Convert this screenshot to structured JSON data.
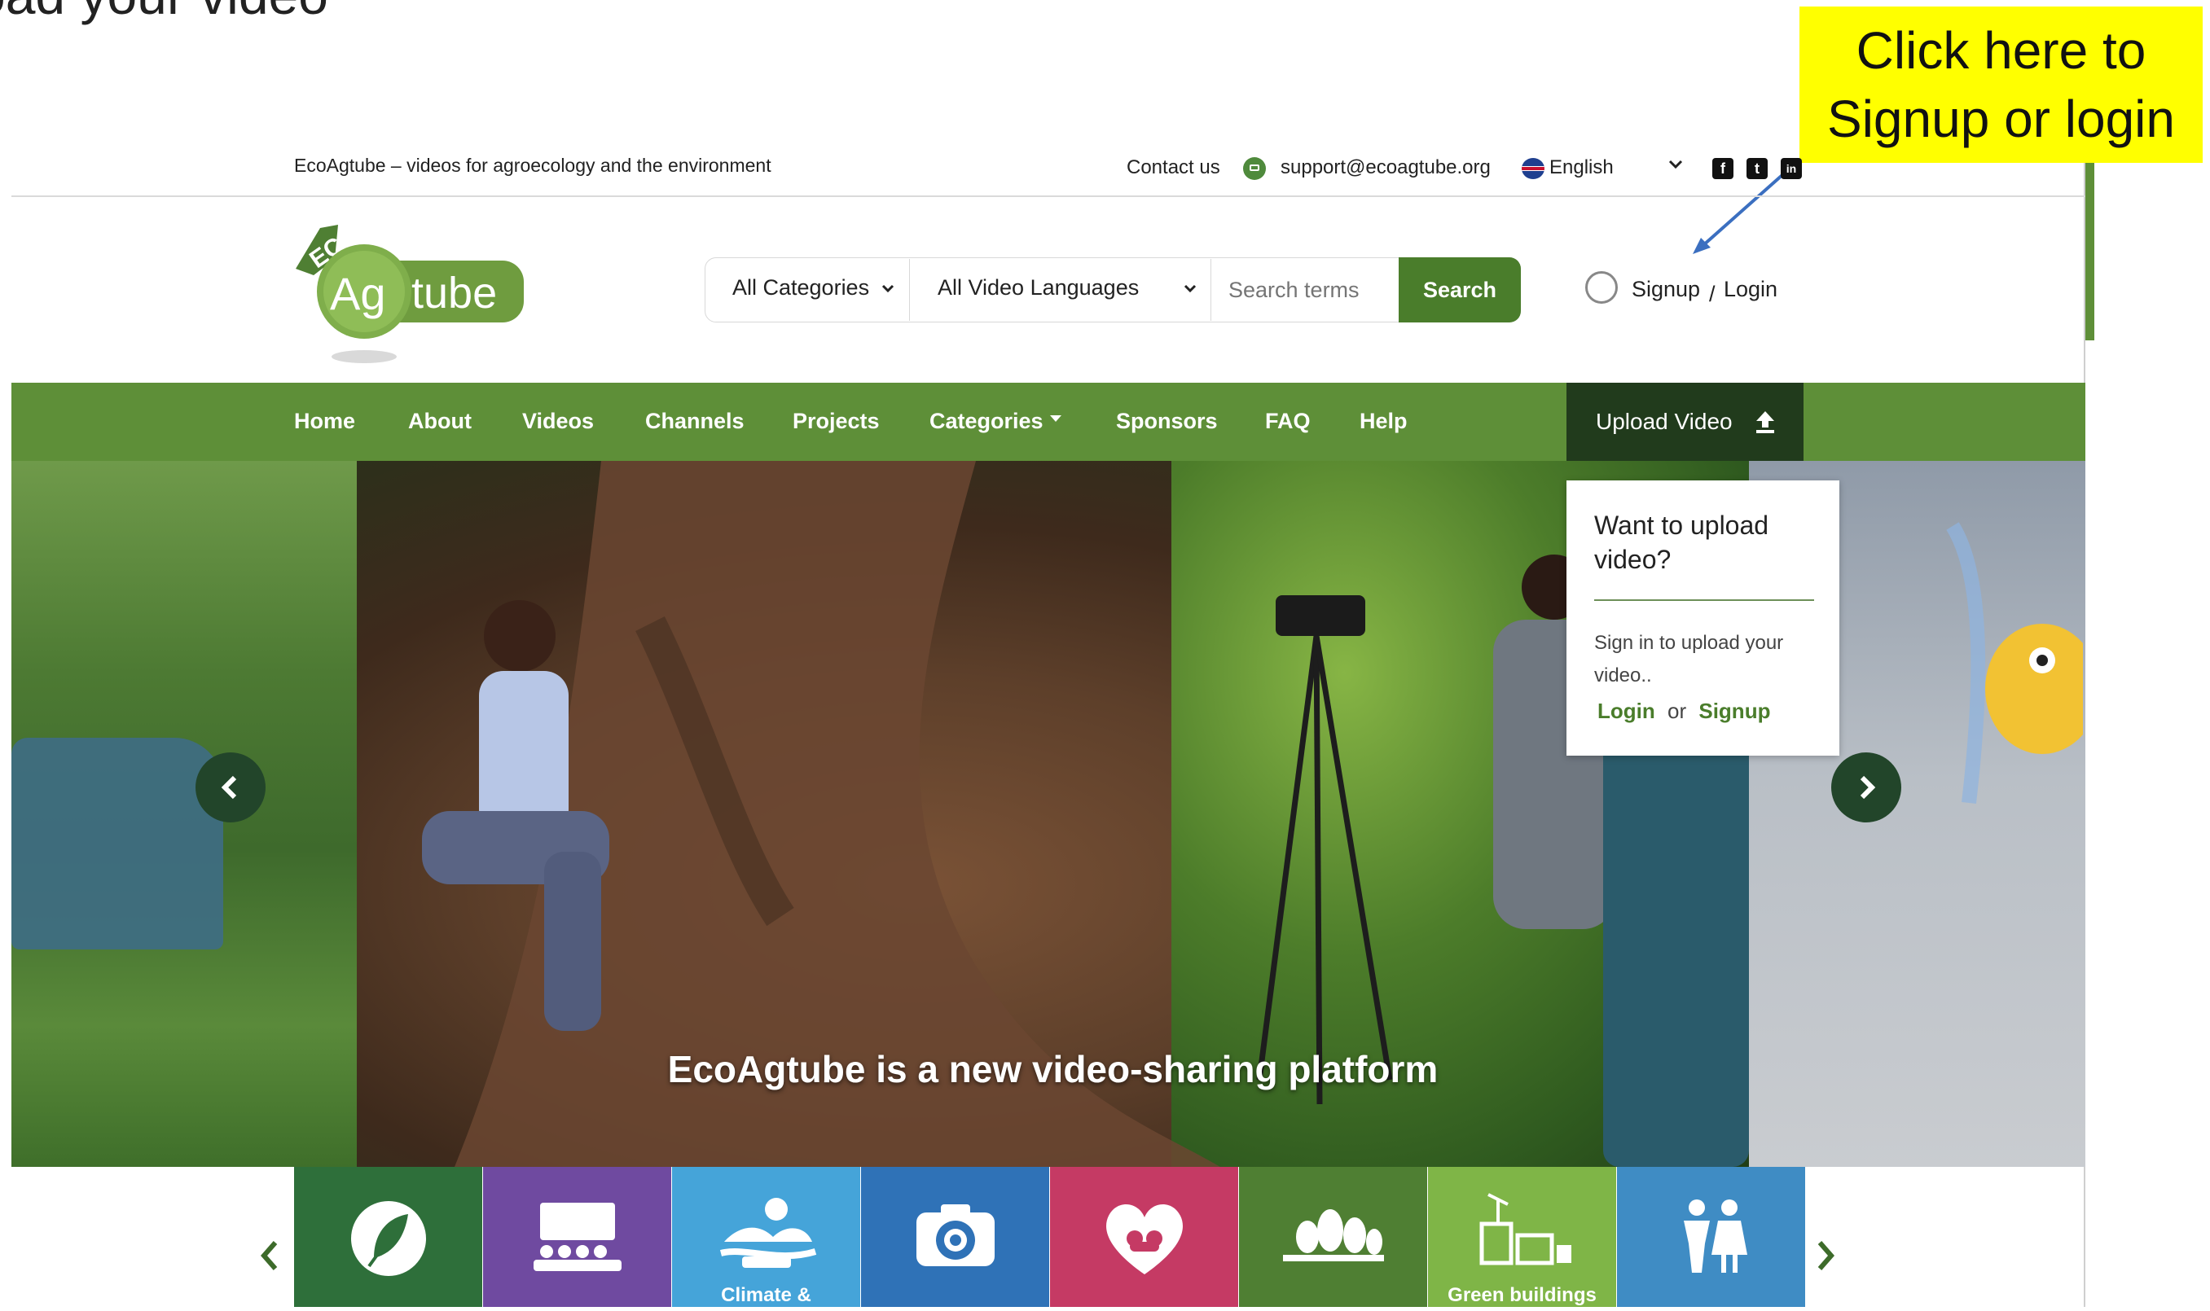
{
  "slide": {
    "heading_partial": "oad your video"
  },
  "callout": {
    "line1": "Click here to",
    "line2": "Signup or login"
  },
  "topbar": {
    "tagline": "EcoAgtube – videos for agroecology and the environment",
    "contact_label": "Contact us",
    "email": "support@ecoagtube.org",
    "language": "English",
    "social": [
      {
        "icon": "facebook-icon",
        "glyph": "f"
      },
      {
        "icon": "twitter-icon",
        "glyph": "t"
      },
      {
        "icon": "linkedin-icon",
        "glyph": "in"
      }
    ]
  },
  "logo": {
    "eco": "ECO",
    "ag": "Ag",
    "tube": "tube"
  },
  "search": {
    "categories_label": "All Categories",
    "languages_label": "All Video Languages",
    "placeholder": "Search terms",
    "button_label": "Search"
  },
  "auth": {
    "signup_label": "Signup",
    "separator": "/",
    "login_label": "Login"
  },
  "nav": {
    "items": [
      "Home",
      "About",
      "Videos",
      "Channels",
      "Projects",
      "Categories",
      "Sponsors",
      "FAQ",
      "Help"
    ],
    "upload_label": "Upload Video"
  },
  "carousel": {
    "caption": "EcoAgtube is a new video-sharing platform"
  },
  "popup": {
    "title": "Want to upload video?",
    "text": "Sign in to upload your video..",
    "login_label": "Login",
    "or_label": "or",
    "signup_label": "Signup"
  },
  "tiles": [
    {
      "color": "#2e6f3a",
      "icon": "leaf-icon",
      "label": ""
    },
    {
      "color": "#6f4aa0",
      "icon": "audience-icon",
      "label": ""
    },
    {
      "color": "#45a4d9",
      "icon": "climate-icon",
      "label": "Climate &"
    },
    {
      "color": "#2f72b7",
      "icon": "camera-icon",
      "label": ""
    },
    {
      "color": "#c53a64",
      "icon": "heart-icon",
      "label": ""
    },
    {
      "color": "#4f7f33",
      "icon": "trees-icon",
      "label": ""
    },
    {
      "color": "#7fb547",
      "icon": "green-building-icon",
      "label": "Green buildings"
    },
    {
      "color": "#3f8cc4",
      "icon": "people-icon",
      "label": ""
    }
  ],
  "colors": {
    "brand_green": "#5e8f38",
    "dark_green": "#213b1c",
    "button_green": "#4a7d2b",
    "callout_yellow": "#ffff00"
  }
}
